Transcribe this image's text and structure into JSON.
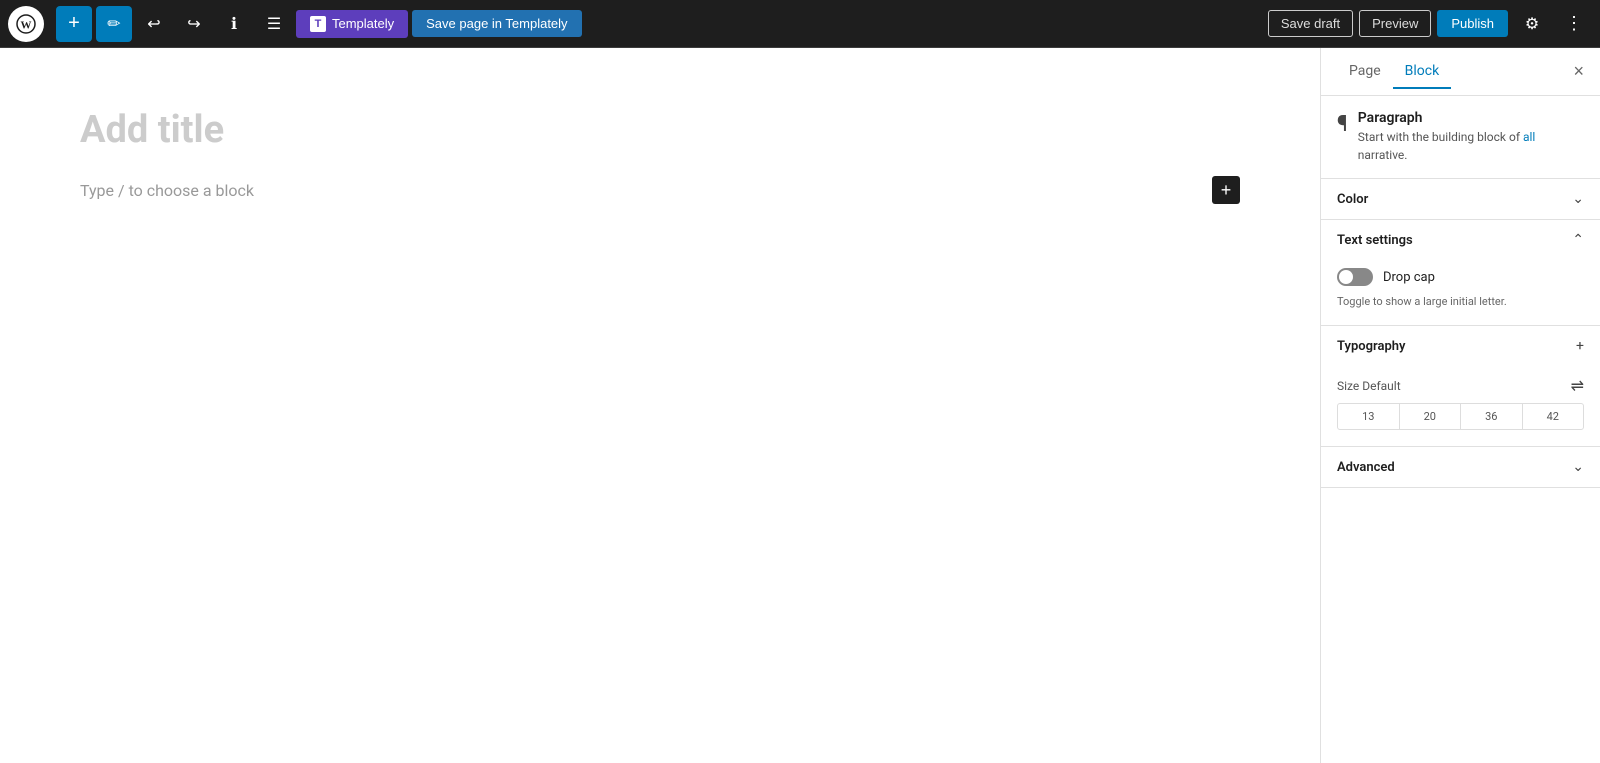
{
  "toolbar": {
    "add_label": "+",
    "pencil_label": "✏",
    "undo_label": "↩",
    "redo_label": "↪",
    "info_label": "ℹ",
    "list_label": "☰",
    "templately_btn_label": "Templately",
    "save_templately_btn_label": "Save page in Templately",
    "save_draft_label": "Save draft",
    "preview_label": "Preview",
    "publish_label": "Publish",
    "settings_label": "⚙",
    "more_label": "⋮"
  },
  "editor": {
    "title_placeholder": "Add title",
    "block_placeholder": "Type / to choose a block"
  },
  "sidebar": {
    "tab_page_label": "Page",
    "tab_block_label": "Block",
    "close_label": "×",
    "block_name": "Paragraph",
    "block_description_part1": "Start with the building block of all",
    "block_description_link": "all",
    "block_description_part2": "narrative.",
    "color_section_label": "Color",
    "text_settings_section_label": "Text settings",
    "drop_cap_label": "Drop cap",
    "drop_cap_hint": "Toggle to show a large initial letter.",
    "typography_section_label": "Typography",
    "size_label": "Size Default",
    "font_sizes": [
      "13",
      "20",
      "36",
      "42"
    ],
    "advanced_section_label": "Advanced"
  }
}
